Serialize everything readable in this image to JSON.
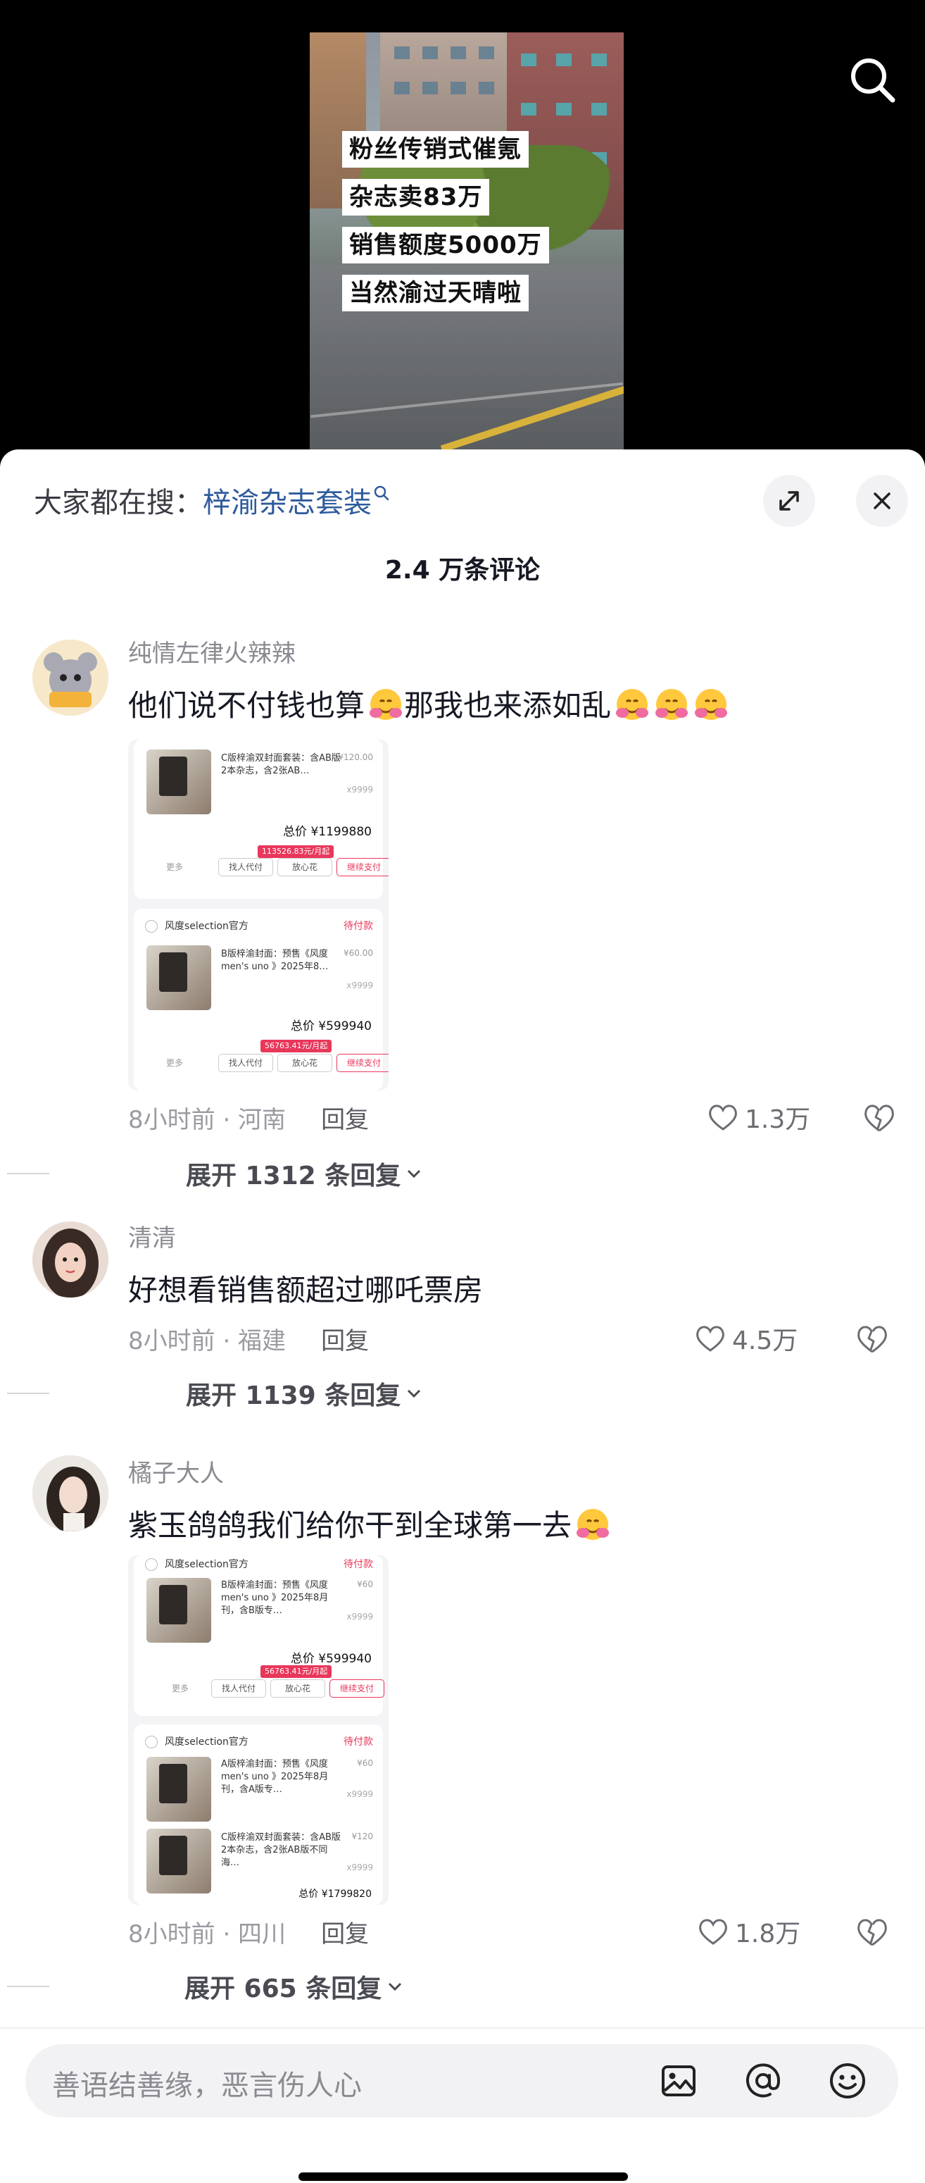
{
  "video": {
    "captions": [
      "粉丝传销式催氪",
      "杂志卖83万",
      "销售额度5000万",
      "当然渝过天晴啦"
    ]
  },
  "header": {
    "search_prefix": "大家都在搜：",
    "search_term": "梓渝杂志套装",
    "comment_count": "2.4 万条评论"
  },
  "comments": [
    {
      "username": "纯情左律火辣辣",
      "text": "他们说不付钱也算",
      "text_tail": "那我也来添如乱",
      "meta": "8小时前 · 河南",
      "reply_label": "回复",
      "likes": "1.3万",
      "expand_label": "展开 1312 条回复",
      "attachment": {
        "card1": {
          "desc": "C版梓渝双封面套装：含AB版2本杂志，含2张AB…",
          "price": "¥120.00",
          "qty": "x9999",
          "total": "总价 ¥1199880",
          "tag": "113526.83元/月起",
          "more": "更多",
          "btn1": "找人代付",
          "btn2": "放心花",
          "btn3": "继续支付"
        },
        "card2": {
          "shop": "风度selection官方",
          "status": "待付款",
          "desc": "B版梓渝封面：预售《风度men's uno 》2025年8…",
          "price": "¥60.00",
          "qty": "x9999",
          "total": "总价 ¥599940",
          "tag": "56763.41元/月起",
          "more": "更多",
          "btn1": "找人代付",
          "btn2": "放心花",
          "btn3": "继续支付"
        }
      }
    },
    {
      "username": "清清",
      "text": "好想看销售额超过哪吒票房",
      "meta": "8小时前 · 福建",
      "reply_label": "回复",
      "likes": "4.5万",
      "expand_label": "展开 1139 条回复"
    },
    {
      "username": "橘子大人",
      "text": "紫玉鸽鸽我们给你干到全球第一去",
      "meta": "8小时前 · 四川",
      "reply_label": "回复",
      "likes": "1.8万",
      "expand_label": "展开 665 条回复",
      "attachment": {
        "card1": {
          "shop": "风度selection官方",
          "status": "待付款",
          "desc": "B版梓渝封面：预售《风度men's uno 》2025年8月刊，含B版专…",
          "price": "¥60",
          "qty": "x9999",
          "total": "总价 ¥599940",
          "tag": "56763.41元/月起",
          "more": "更多",
          "btn1": "找人代付",
          "btn2": "放心花",
          "btn3": "继续支付"
        },
        "card2": {
          "shop": "风度selection官方",
          "status": "待付款",
          "desc": "A版梓渝封面：预售《风度men's uno 》2025年8月刊，含A版专…",
          "price": "¥60",
          "qty": "x9999",
          "desc2": "C版梓渝双封面套装：含AB版2本杂志，含2张AB版不同海…",
          "price2": "¥120",
          "qty2": "x9999",
          "total": "总价 ¥1799820"
        }
      }
    }
  ],
  "input": {
    "placeholder": "善语结善缘，恶言伤人心"
  },
  "icons": [
    "search-icon",
    "expand-icon",
    "close-icon",
    "heart-icon",
    "dislike-heart-icon",
    "chevron-down-icon",
    "image-icon",
    "at-icon",
    "emoji-icon"
  ]
}
